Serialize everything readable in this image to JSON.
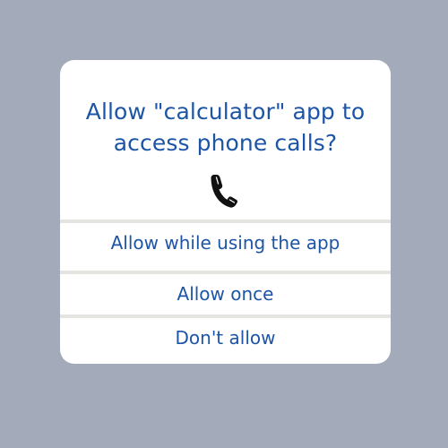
{
  "dialog": {
    "title_line1": "Allow \"calculator\" app to",
    "title_line2": "access phone calls?",
    "icon": "phone-icon",
    "options": [
      {
        "label": "Allow while using the app"
      },
      {
        "label": "Allow once"
      },
      {
        "label": "Don't allow"
      }
    ]
  },
  "colors": {
    "background": "#a3aab9",
    "dialog": "#ffffff",
    "accent_text": "#1d55a6",
    "divider": "#e4e4e1",
    "icon": "#111111"
  }
}
